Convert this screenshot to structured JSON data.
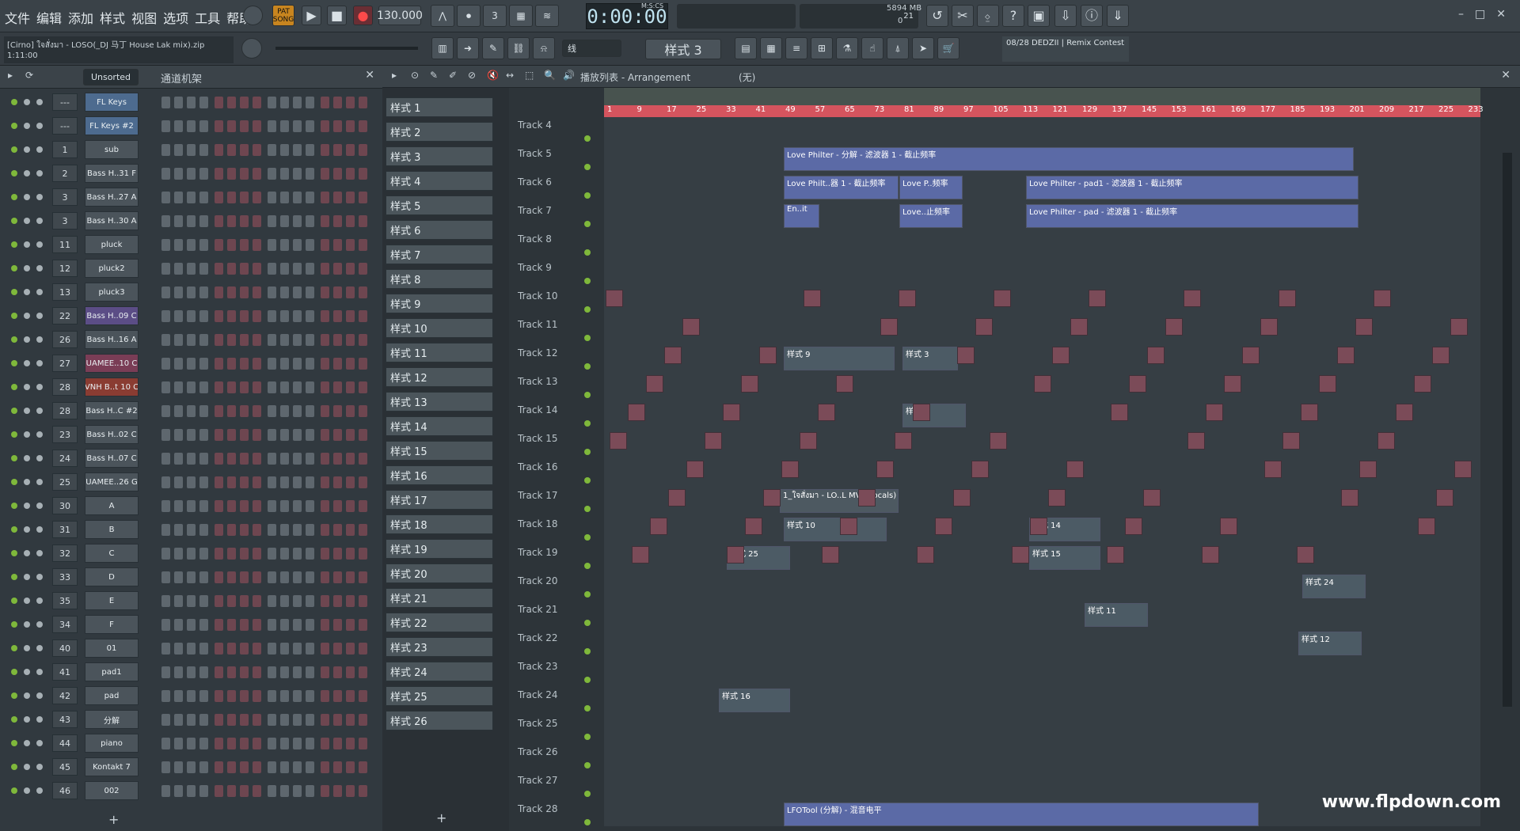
{
  "menu": [
    "文件",
    "编辑",
    "添加",
    "样式",
    "视图",
    "选项",
    "工具",
    "帮助"
  ],
  "transport": {
    "pat": "PAT",
    "song": "SONG",
    "tempo": "130.000",
    "time": "0:00:00",
    "timeLabel": "M:S:CS",
    "cpu": "21",
    "mem": "5894 MB",
    "poly": "0"
  },
  "project": {
    "name": "[Cirno] ใจสั่งมา - LOSO(_DJ 马丁 House Lak mix).zip",
    "time": "1:11:00"
  },
  "toolbar2": {
    "mode": "线",
    "pattern": "样式 3",
    "news": "08/28  DEDZII | Remix Contest"
  },
  "rack": {
    "filter": "Unsorted",
    "title": "通道机架",
    "add": "+"
  },
  "channels": [
    {
      "num": "---",
      "name": "FL Keys",
      "color": "#4d6b8f"
    },
    {
      "num": "---",
      "name": "FL Keys #2",
      "color": "#4d6b8f"
    },
    {
      "num": "1",
      "name": "sub",
      "color": "#4b545b"
    },
    {
      "num": "2",
      "name": "Bass H..31 F",
      "color": "#4b545b"
    },
    {
      "num": "3",
      "name": "Bass H..27 A",
      "color": "#4b545b"
    },
    {
      "num": "3",
      "name": "Bass H..30 A",
      "color": "#4b545b"
    },
    {
      "num": "11",
      "name": "pluck",
      "color": "#4b545b"
    },
    {
      "num": "12",
      "name": "pluck2",
      "color": "#4b545b"
    },
    {
      "num": "13",
      "name": "pluck3",
      "color": "#4b545b"
    },
    {
      "num": "22",
      "name": "Bass H..09 C",
      "color": "#5b4d86"
    },
    {
      "num": "26",
      "name": "Bass H..16 A",
      "color": "#4b545b"
    },
    {
      "num": "27",
      "name": "UAMEE..10 C",
      "color": "#7a3d56"
    },
    {
      "num": "28",
      "name": "VNH B..t 10 C",
      "color": "#8a3c32"
    },
    {
      "num": "28",
      "name": "Bass H..C #2",
      "color": "#4b545b"
    },
    {
      "num": "23",
      "name": "Bass H..02 C",
      "color": "#4b545b"
    },
    {
      "num": "24",
      "name": "Bass H..07 C",
      "color": "#4b545b"
    },
    {
      "num": "25",
      "name": "UAMEE..26 G",
      "color": "#4b545b"
    },
    {
      "num": "30",
      "name": "A",
      "color": "#4b545b"
    },
    {
      "num": "31",
      "name": "B",
      "color": "#4b545b"
    },
    {
      "num": "32",
      "name": "C",
      "color": "#4b545b"
    },
    {
      "num": "33",
      "name": "D",
      "color": "#4b545b"
    },
    {
      "num": "35",
      "name": "E",
      "color": "#4b545b"
    },
    {
      "num": "34",
      "name": "F",
      "color": "#4b545b"
    },
    {
      "num": "40",
      "name": "01",
      "color": "#4b545b"
    },
    {
      "num": "41",
      "name": "pad1",
      "color": "#4b545b"
    },
    {
      "num": "42",
      "name": "pad",
      "color": "#4b545b"
    },
    {
      "num": "43",
      "name": "分解",
      "color": "#4b545b"
    },
    {
      "num": "44",
      "name": "piano",
      "color": "#4b545b"
    },
    {
      "num": "45",
      "name": "Kontakt 7",
      "color": "#4b545b"
    },
    {
      "num": "46",
      "name": "002",
      "color": "#4b545b"
    }
  ],
  "patterns": [
    "样式 1",
    "样式 2",
    "样式 3",
    "样式 4",
    "样式 5",
    "样式 6",
    "样式 7",
    "样式 8",
    "样式 9",
    "样式 10",
    "样式 11",
    "样式 12",
    "样式 13",
    "样式 14",
    "样式 15",
    "样式 16",
    "样式 17",
    "样式 18",
    "样式 19",
    "样式 20",
    "样式 21",
    "样式 22",
    "样式 23",
    "样式 24",
    "样式 25",
    "样式 26"
  ],
  "playlist": {
    "title": "播放列表 - Arrangement",
    "sub": "(无)",
    "timeline": [
      "1",
      "9",
      "17",
      "25",
      "33",
      "41",
      "49",
      "57",
      "65",
      "73",
      "81",
      "89",
      "97",
      "105",
      "113",
      "121",
      "129",
      "137",
      "145",
      "153",
      "161",
      "169",
      "177",
      "185",
      "193",
      "201",
      "209",
      "217",
      "225",
      "233"
    ]
  },
  "tracks": [
    "Track 4",
    "Track 5",
    "Track 6",
    "Track 7",
    "Track 8",
    "Track 9",
    "Track 10",
    "Track 11",
    "Track 12",
    "Track 13",
    "Track 14",
    "Track 15",
    "Track 16",
    "Track 17",
    "Track 18",
    "Track 19",
    "Track 20",
    "Track 21",
    "Track 22",
    "Track 23",
    "Track 24",
    "Track 25",
    "Track 26",
    "Track 27",
    "Track 28"
  ],
  "clips": [
    {
      "label": "Love Philter - 分解 - 滤波器 1 - 截止频率",
      "color": "#5b6aa6"
    },
    {
      "label": "Love Philt..器 1 - 截止频率",
      "color": "#5b6aa6"
    },
    {
      "label": "Love P..频率",
      "color": "#5b6aa6"
    },
    {
      "label": "Love Philter - pad1 - 滤波器 1 - 截止频率",
      "color": "#5b6aa6"
    },
    {
      "label": "En..it",
      "color": "#5b6aa6"
    },
    {
      "label": "Love..止频率",
      "color": "#5b6aa6"
    },
    {
      "label": "Love Philter - pad - 滤波器 1 - 截止频率",
      "color": "#5b6aa6"
    },
    {
      "label": "样式 9",
      "color": "#4c5b65"
    },
    {
      "label": "样式 3",
      "color": "#4c5b65"
    },
    {
      "label": "样式 2",
      "color": "#4c5b65"
    },
    {
      "label": "1_ใจสั่งมา - LO..L MV_(Vocals)",
      "color": "#4d5961"
    },
    {
      "label": "样式 10",
      "color": "#4c5b65"
    },
    {
      "label": "样式 14",
      "color": "#4c5b65"
    },
    {
      "label": "样式 16",
      "color": "#4c5b65"
    },
    {
      "label": "样式 25",
      "color": "#4c5b65"
    },
    {
      "label": "样式 15",
      "color": "#4c5b65"
    },
    {
      "label": "样式 24",
      "color": "#4c5b65"
    },
    {
      "label": "样式 11",
      "color": "#4c5b65"
    },
    {
      "label": "样式 12",
      "color": "#4c5b65"
    },
    {
      "label": "LFOTool (分解) - 混音电平",
      "color": "#5b6aa6"
    }
  ],
  "watermark": "www.flpdown.com"
}
